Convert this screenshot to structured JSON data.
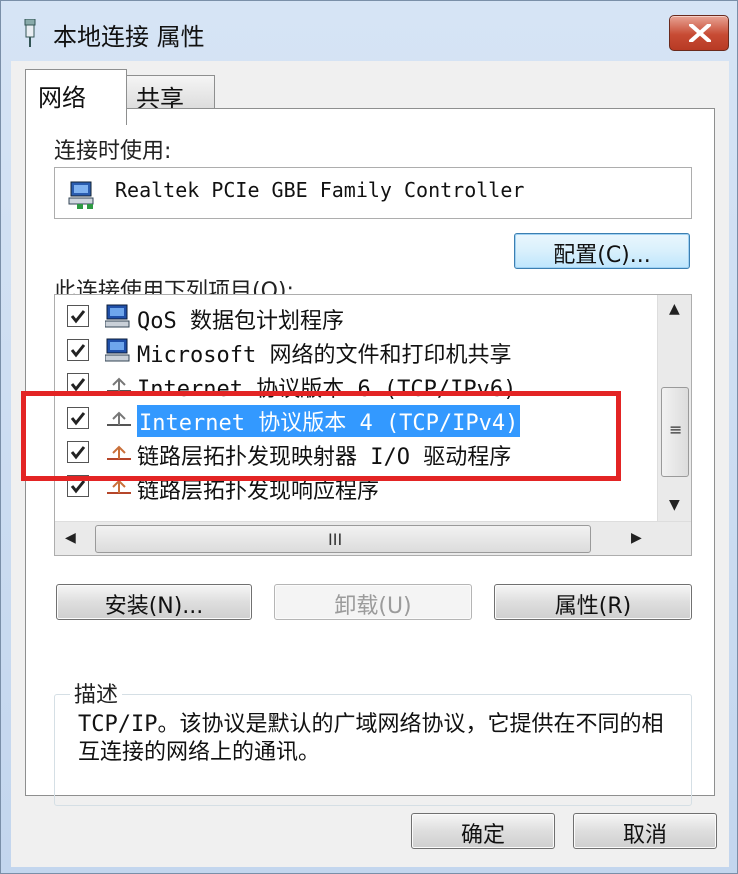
{
  "window": {
    "title": "本地连接 属性"
  },
  "tabs": [
    "网络",
    "共享"
  ],
  "connect_using_label": "连接时使用:",
  "adapter_name": "Realtek PCIe GBE Family Controller",
  "configure_button": "配置(C)...",
  "items_label": "此连接使用下列项目(O):",
  "items": [
    {
      "label": "QoS 数据包计划程序",
      "checked": true,
      "icon": "network-service-icon"
    },
    {
      "label": "Microsoft 网络的文件和打印机共享",
      "checked": true,
      "icon": "network-service-icon"
    },
    {
      "label": "Internet 协议版本 6 (TCP/IPv6)",
      "checked": true,
      "icon": "protocol-icon"
    },
    {
      "label": "Internet 协议版本 4 (TCP/IPv4)",
      "checked": true,
      "icon": "protocol-icon",
      "selected": true
    },
    {
      "label": "链路层拓扑发现映射器 I/O 驱动程序",
      "checked": true,
      "icon": "protocol-icon"
    },
    {
      "label": "链路层拓扑发现响应程序",
      "checked": true,
      "icon": "protocol-icon"
    }
  ],
  "scroll_grip_v": "≡",
  "scroll_grip_h": "III",
  "buttons": {
    "install": "安装(N)...",
    "uninstall": "卸载(U)",
    "properties": "属性(R)",
    "ok": "确定",
    "cancel": "取消"
  },
  "description": {
    "title": "描述",
    "text": "TCP/IP。该协议是默认的广域网络协议，它提供在不同的相互连接的网络上的通讯。"
  },
  "colors": {
    "selection": "#3399ff",
    "highlight_box": "#e32424",
    "close": "#c74b34"
  }
}
